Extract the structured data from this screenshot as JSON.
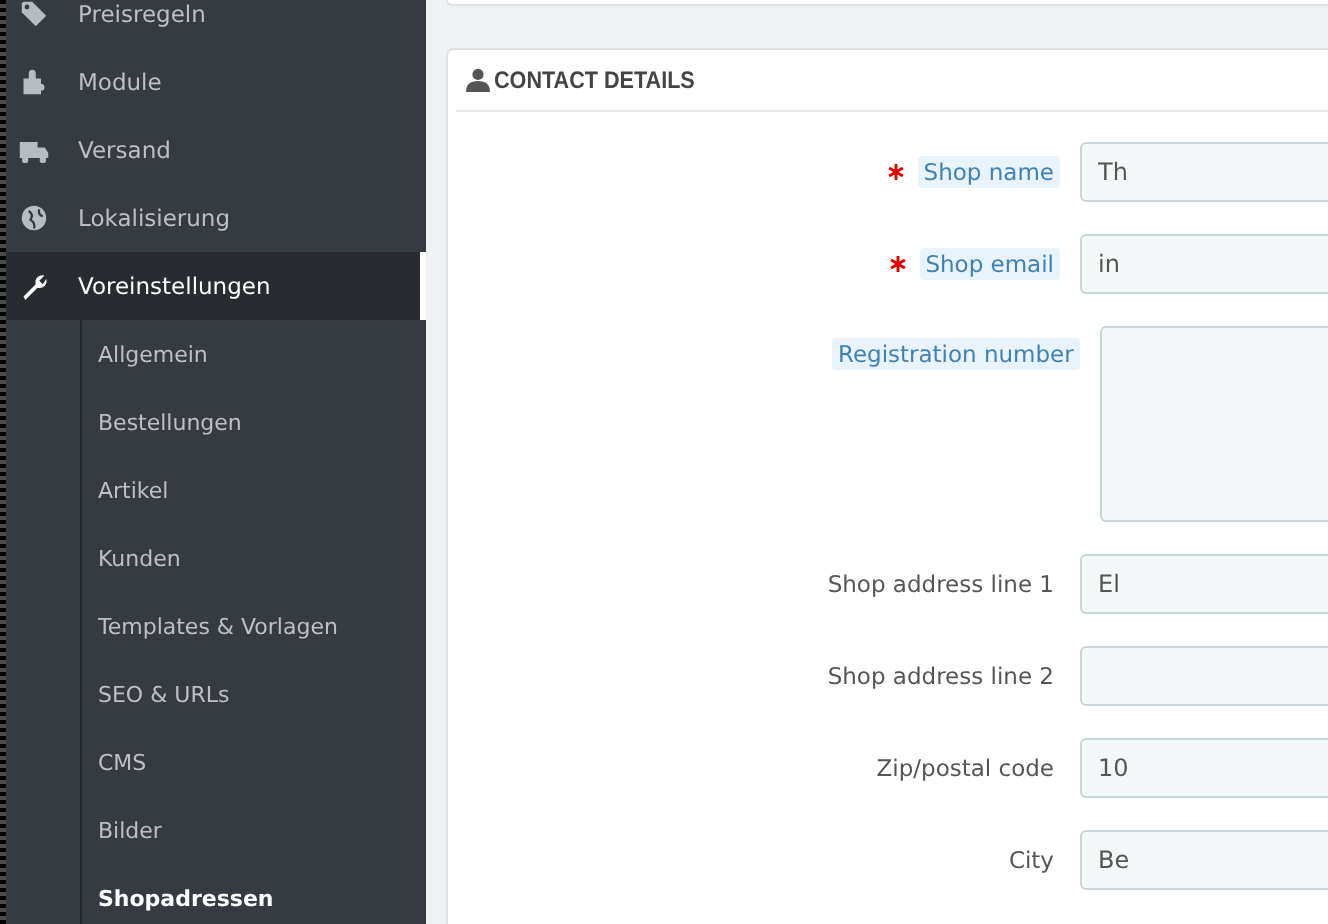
{
  "sidebar": {
    "items": [
      {
        "label": "Preisregeln",
        "selected": false
      },
      {
        "label": "Module",
        "selected": false
      },
      {
        "label": "Versand",
        "selected": false
      },
      {
        "label": "Lokalisierung",
        "selected": false
      },
      {
        "label": "Voreinstellungen",
        "selected": true,
        "children": [
          {
            "label": "Allgemein",
            "selected": false
          },
          {
            "label": "Bestellungen",
            "selected": false
          },
          {
            "label": "Artikel",
            "selected": false
          },
          {
            "label": "Kunden",
            "selected": false
          },
          {
            "label": "Templates & Vorlagen",
            "selected": false
          },
          {
            "label": "SEO & URLs",
            "selected": false
          },
          {
            "label": "CMS",
            "selected": false
          },
          {
            "label": "Bilder",
            "selected": false
          },
          {
            "label": "Shopadressen",
            "selected": true
          }
        ]
      }
    ]
  },
  "panel": {
    "title": "CONTACT DETAILS",
    "fields": [
      {
        "label": "Shop name",
        "required": true,
        "help": true,
        "kind": "input",
        "value": "Th"
      },
      {
        "label": "Shop email",
        "required": true,
        "help": true,
        "kind": "input",
        "value": "in"
      },
      {
        "label": "Registration number",
        "required": false,
        "help": true,
        "kind": "textarea"
      },
      {
        "label": "Shop address line 1",
        "required": false,
        "help": false,
        "kind": "input",
        "value": "El"
      },
      {
        "label": "Shop address line 2",
        "required": false,
        "help": false,
        "kind": "input"
      },
      {
        "label": "Zip/postal code",
        "required": false,
        "help": false,
        "kind": "input",
        "value": "10"
      },
      {
        "label": "City",
        "required": false,
        "help": false,
        "kind": "input",
        "value": "Be"
      }
    ]
  }
}
